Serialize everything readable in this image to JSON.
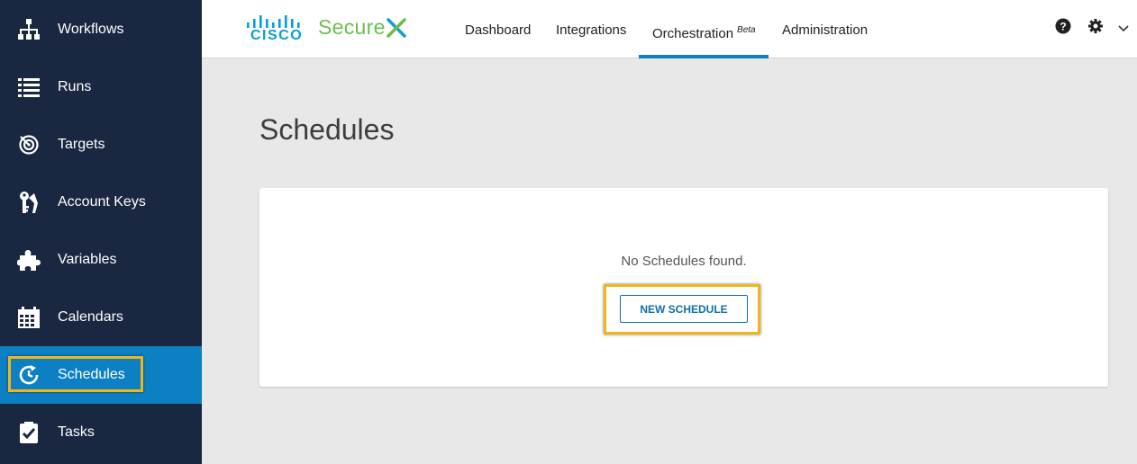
{
  "sidebar": {
    "items": [
      {
        "label": "Workflows",
        "icon": "workflow-icon"
      },
      {
        "label": "Runs",
        "icon": "list-icon"
      },
      {
        "label": "Targets",
        "icon": "target-icon"
      },
      {
        "label": "Account Keys",
        "icon": "key-icon"
      },
      {
        "label": "Variables",
        "icon": "puzzle-icon"
      },
      {
        "label": "Calendars",
        "icon": "calendar-icon"
      },
      {
        "label": "Schedules",
        "icon": "schedule-clock-icon",
        "active": true
      },
      {
        "label": "Tasks",
        "icon": "task-check-icon"
      }
    ]
  },
  "header": {
    "logo_text": "CISCO",
    "brand_text": "Secure",
    "tabs": [
      {
        "label": "Dashboard"
      },
      {
        "label": "Integrations"
      },
      {
        "label": "Orchestration",
        "badge": "Beta",
        "active": true
      },
      {
        "label": "Administration"
      }
    ],
    "icons": [
      "help-icon",
      "gear-icon",
      "chevron-down-icon"
    ]
  },
  "main": {
    "title": "Schedules",
    "empty_message": "No Schedules found.",
    "new_button_label": "NEW SCHEDULE"
  },
  "colors": {
    "sidebar_bg": "#1a2741",
    "active_blue": "#0d80c4",
    "highlight": "#f0b51a",
    "brand_green": "#6abf4b",
    "cisco_blue": "#049fd9"
  }
}
